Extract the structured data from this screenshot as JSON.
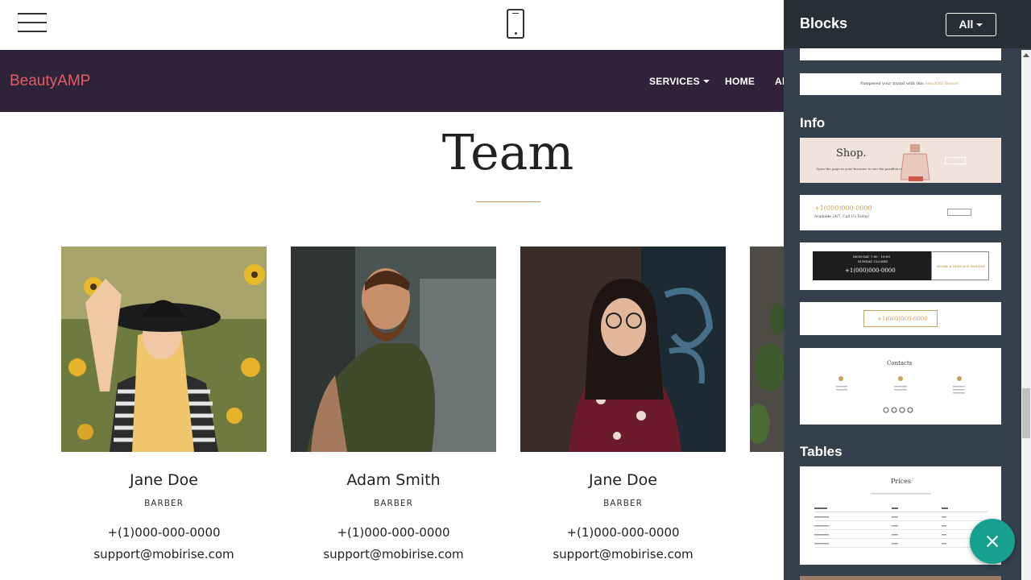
{
  "editor": {
    "menu_icon": "hamburger-icon",
    "device_icon": "mobile-phone-icon"
  },
  "site": {
    "brand": "BeautyAMP",
    "nav": {
      "services": "SERVICES",
      "home": "HOME",
      "about_partial": "Al"
    }
  },
  "team": {
    "title": "Team",
    "members": [
      {
        "name": "Jane Doe",
        "role": "BARBER",
        "phone": "+(1)000-000-0000",
        "email": "support@mobirise.com"
      },
      {
        "name": "Adam Smith",
        "role": "BARBER",
        "phone": "+(1)000-000-0000",
        "email": "support@mobirise.com"
      },
      {
        "name": "Jane Doe",
        "role": "BARBER",
        "phone": "+(1)000-000-0000",
        "email": "support@mobirise.com"
      }
    ]
  },
  "panel": {
    "title": "Blocks",
    "filter": "All",
    "categories": {
      "info": "Info",
      "tables": "Tables"
    },
    "thumbs": {
      "pampered": "Pampered your brand with this",
      "pampered_accent": "beautiful theme!",
      "shop_title": "Shop.",
      "shop_sub": "Open the page in your browser to see the parallax effect.",
      "phone": "+1(000)000-0000",
      "available": "Available 24/7, Call Us Today!",
      "hours": "MON-SAT 7:00 - 19:00",
      "sunday": "SUNDAY CLOSED",
      "book": "BOOK A SERVICE ONLINE",
      "contacts": "Contacts",
      "prices": "Prices"
    }
  },
  "colors": {
    "navbar": "#2f2339",
    "brand": "#e35b68",
    "accent_gold": "#b9975b",
    "panel": "#34414c",
    "panel_head": "#262e36",
    "fab": "#16a08e"
  }
}
